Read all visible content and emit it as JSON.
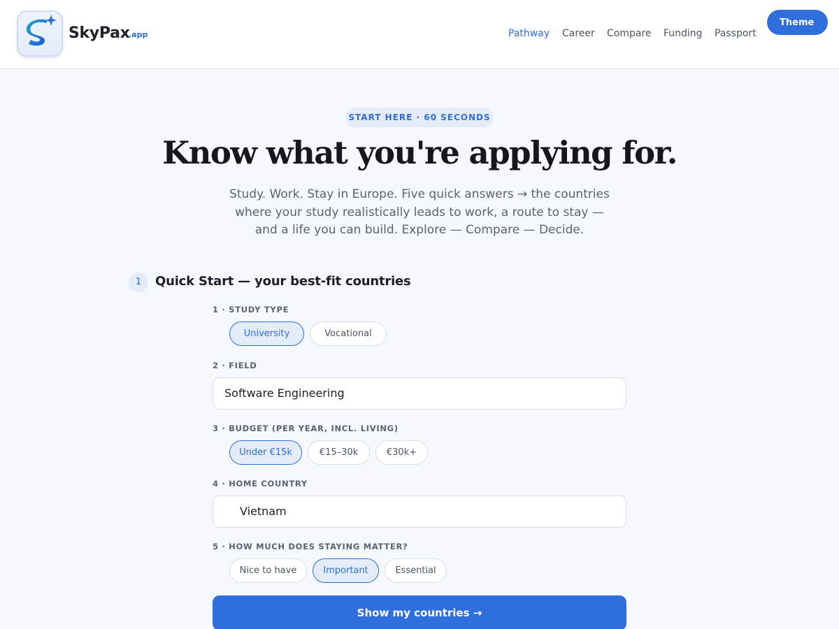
{
  "header": {
    "brand": "SkyPax",
    "brand_suffix": ".app",
    "nav": [
      "Pathway",
      "Career",
      "Compare",
      "Funding",
      "Passport"
    ],
    "active_nav": "Pathway",
    "theme_label": "Theme"
  },
  "hero": {
    "eyebrow": "START HERE · 60 SECONDS",
    "headline": "Know what you're applying for.",
    "lede_lines": [
      "Study. Work. Stay in Europe. Five quick answers → the countries",
      "where your study realistically leads to work, a route to stay —",
      "and a life you can build. Explore — Compare — Decide."
    ]
  },
  "quick_start": {
    "step_number": "1",
    "title": "Quick Start — your best-fit countries",
    "q1": {
      "label": "1 · STUDY TYPE",
      "options": [
        "University",
        "Vocational"
      ],
      "selected": "University"
    },
    "q2": {
      "label": "2 · FIELD",
      "value": "Software Engineering"
    },
    "q3": {
      "label": "3 · BUDGET (PER YEAR, INCL. LIVING)",
      "options": [
        "Under €15k",
        "€15–30k",
        "€30k+"
      ],
      "selected": "Under €15k"
    },
    "q4": {
      "label": "4 · HOME COUNTRY",
      "value": "Vietnam"
    },
    "q5": {
      "label": "5 · HOW MUCH DOES STAYING MATTER?",
      "options": [
        "Nice to have",
        "Important",
        "Essential"
      ],
      "selected": "Important"
    },
    "submit_label": "Show my countries →"
  },
  "colors": {
    "accent": "#2f6fdb",
    "accent_soft": "#e3ecf8",
    "background": "#f5f8fc"
  }
}
